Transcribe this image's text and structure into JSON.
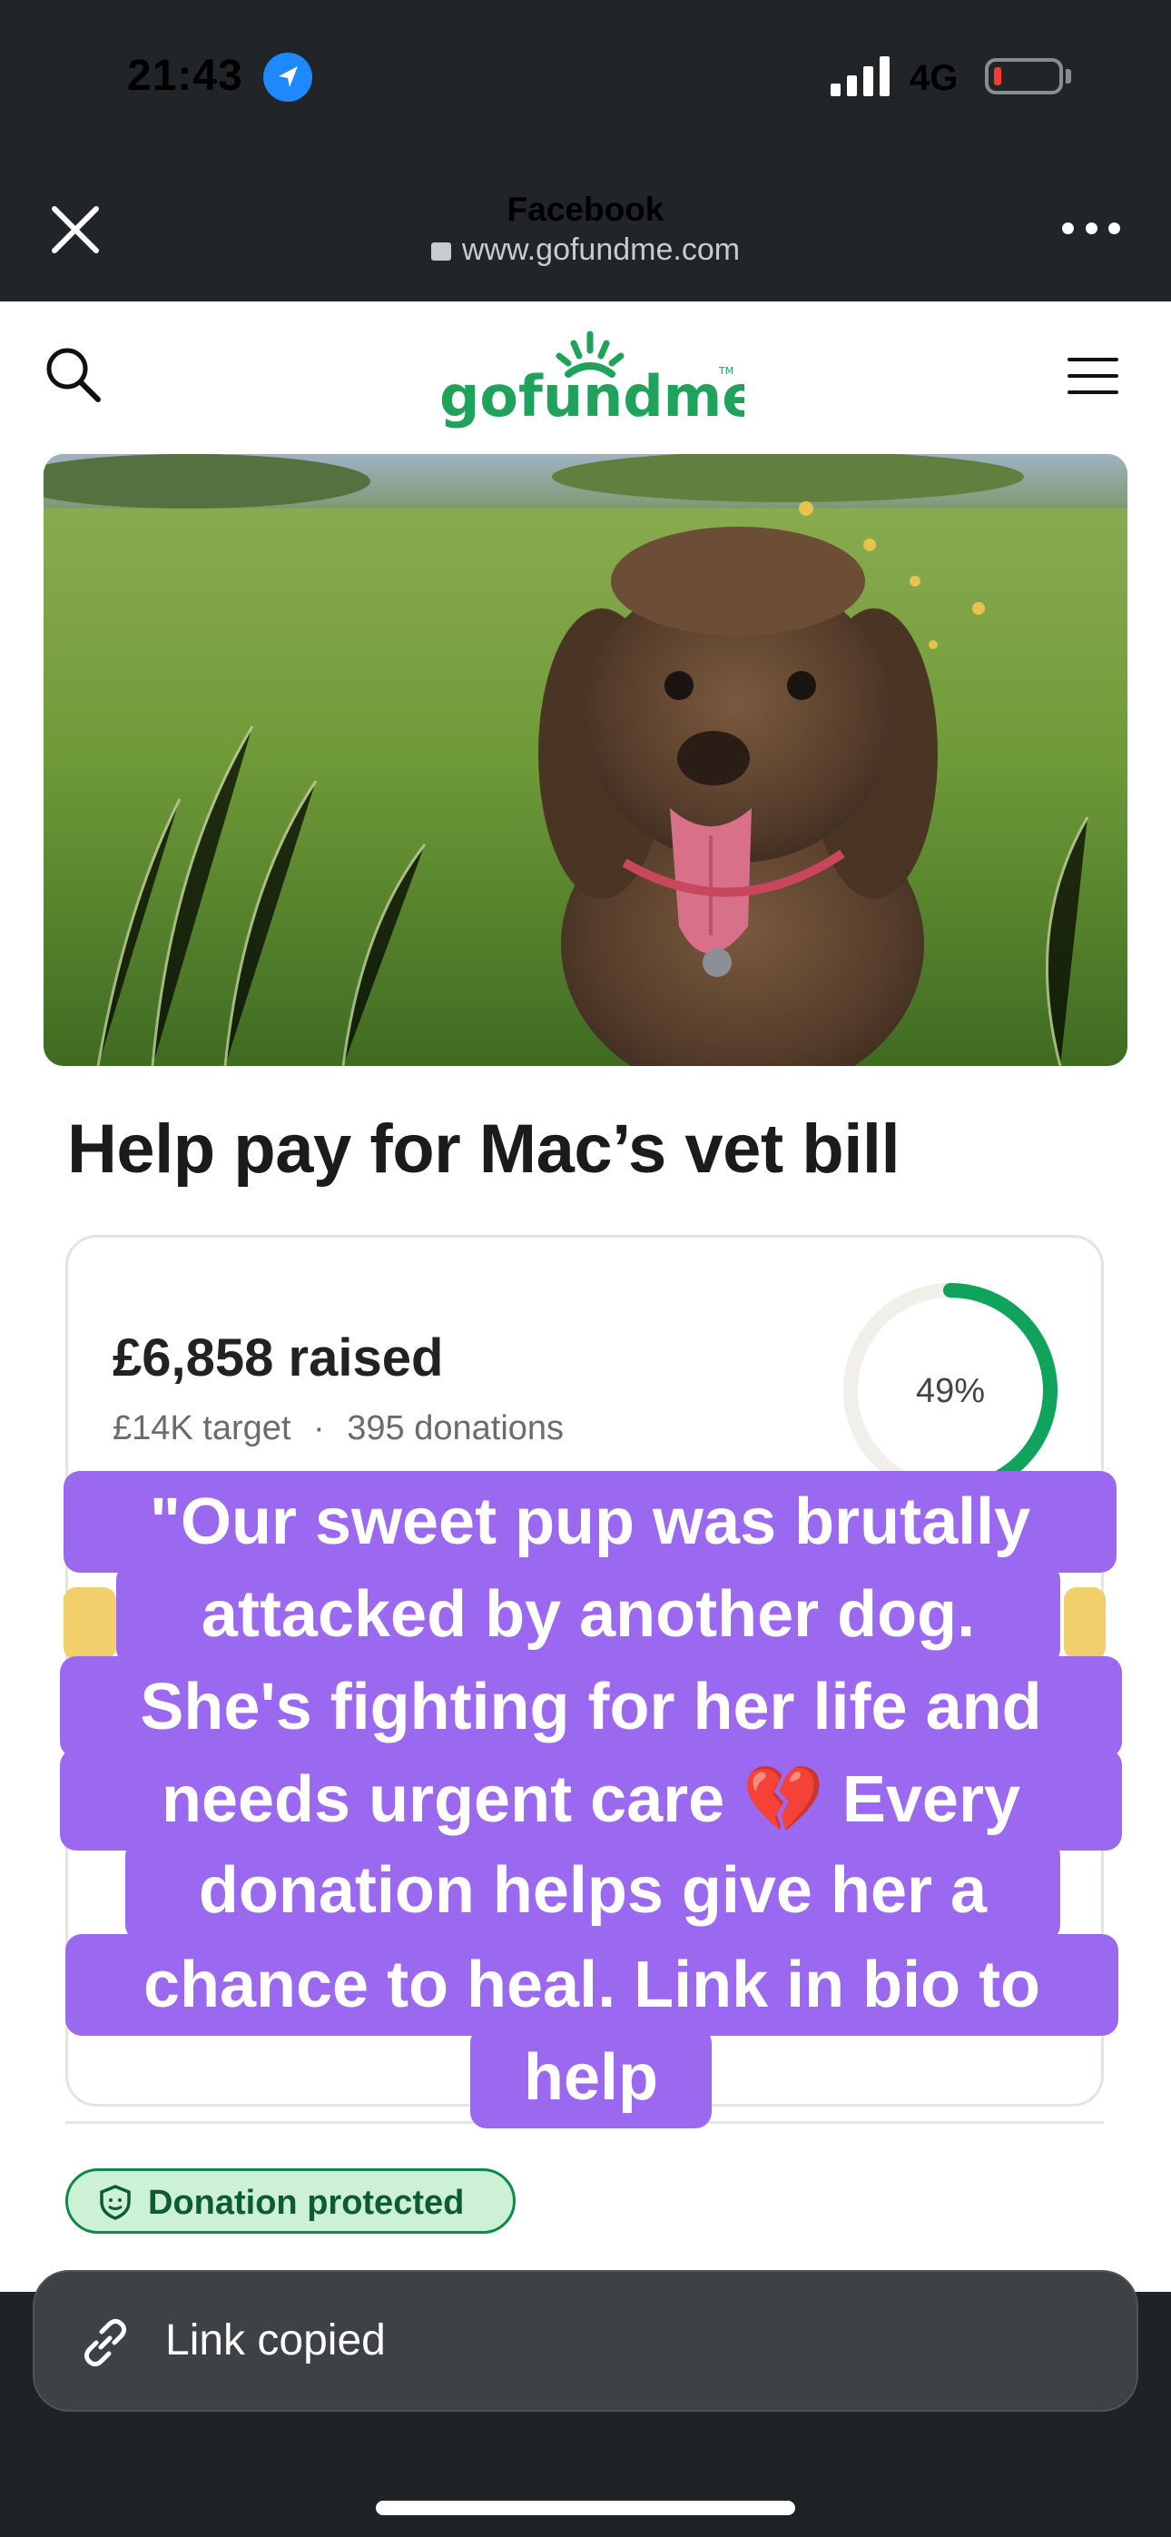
{
  "status_bar": {
    "time": "21:43",
    "network": "4G",
    "battery_level": 0.08
  },
  "browser": {
    "title": "Facebook",
    "url": "www.gofundme.com"
  },
  "site": {
    "logo_text": "gofundme",
    "trademark": "TM",
    "brand_color": "#1fa35c"
  },
  "campaign": {
    "title": "Help pay for Mac’s vet bill",
    "raised": "£6,858 raised",
    "target": "£14K target",
    "separator": "·",
    "donations": "395 donations",
    "progress_label": "49%",
    "progress": 0.49,
    "badge": "Donation protected"
  },
  "caption": {
    "lines": [
      "\"Our sweet pup was brutally",
      "attacked by another dog.",
      "She's fighting for her life and",
      "needs urgent care 💔 Every",
      "donation helps give her a",
      "chance to heal. Link in bio to",
      "help"
    ],
    "color": "#9b68f0"
  },
  "toast": {
    "text": "Link copied"
  }
}
